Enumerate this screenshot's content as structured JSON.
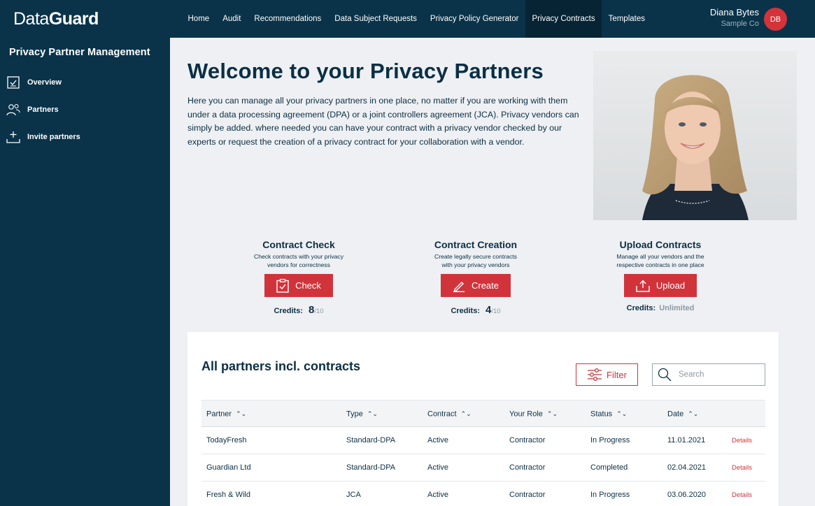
{
  "app": {
    "logo_part1": "Data",
    "logo_part2": "Guard"
  },
  "nav": {
    "items": [
      {
        "label": "Home",
        "active": false
      },
      {
        "label": "Audit",
        "active": false
      },
      {
        "label": "Recommendations",
        "active": false
      },
      {
        "label": "Data Subject Requests",
        "active": false
      },
      {
        "label": "Privacy Policy Generator",
        "active": false
      },
      {
        "label": "Privacy Contracts",
        "active": true
      },
      {
        "label": "Templates",
        "active": false
      }
    ]
  },
  "user": {
    "name": "Diana Bytes",
    "company": "Sample Co",
    "initials": "DB"
  },
  "sidebar": {
    "title": "Privacy Partner Management",
    "items": [
      {
        "label": "Overview",
        "icon": "overview-icon"
      },
      {
        "label": "Partners",
        "icon": "partners-icon"
      },
      {
        "label": "Invite partners",
        "icon": "invite-icon"
      }
    ]
  },
  "hero": {
    "title": "Welcome to your Privacy Partners",
    "text": "Here you can manage all your privacy partners in one place, no matter if you are working with them under a data processing agreement (DPA) or a joint controllers agreement (JCA). Privacy vendors can simply be added. where needed you can have your contract with a privacy vendor checked by our experts or request the creation of a privacy contract for your collaboration with a vendor."
  },
  "actions": [
    {
      "title": "Contract Check",
      "desc1": "Check contracts with your privacy",
      "desc2": "vendors for correctness",
      "button": "Check",
      "icon": "clipboard-check-icon",
      "credits_label": "Credits:",
      "credits_value": "8",
      "credits_max": "/10"
    },
    {
      "title": "Contract Creation",
      "desc1": "Create legally secure contracts",
      "desc2": "with your privacy vendors",
      "button": "Create",
      "icon": "pen-icon",
      "credits_label": "Credits:",
      "credits_value": "4",
      "credits_max": "/10"
    },
    {
      "title": "Upload Contracts",
      "desc1": "Manage all your vendors and the",
      "desc2": "respective contracts in one place",
      "button": "Upload",
      "icon": "upload-icon",
      "credits_label": "Credits:",
      "credits_value": "Unlimited"
    }
  ],
  "partners": {
    "title": "All partners incl. contracts",
    "filter_label": "Filter",
    "search_placeholder": "Search",
    "columns": [
      "Partner",
      "Type",
      "Contract",
      "Your Role",
      "Status",
      "Date"
    ],
    "rows": [
      {
        "partner": "TodayFresh",
        "type": "Standard-DPA",
        "contract": "Active",
        "role": "Contractor",
        "status": "In Progress",
        "date": "11.01.2021",
        "action": "Details"
      },
      {
        "partner": "Guardian Ltd",
        "type": "Standard-DPA",
        "contract": "Active",
        "role": "Contractor",
        "status": "Completed",
        "date": "02.04.2021",
        "action": "Details"
      },
      {
        "partner": "Fresh & Wild",
        "type": "JCA",
        "contract": "Active",
        "role": "Contractor",
        "status": "In Progress",
        "date": "03.06.2020",
        "action": "Details"
      }
    ]
  },
  "colors": {
    "navy": "#0a3349",
    "accent_red": "#d1333b",
    "background": "#eef0f3"
  }
}
